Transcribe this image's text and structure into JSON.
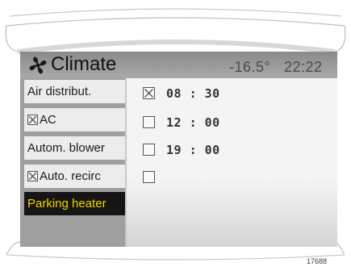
{
  "header": {
    "title": "Climate",
    "fan_icon": "fan-icon",
    "temperature": "-16.5°",
    "clock": "22:22"
  },
  "sidebar": {
    "items": [
      {
        "label": "Air distribut.",
        "checkbox": false,
        "checked": false,
        "selected": false
      },
      {
        "label": "AC",
        "checkbox": true,
        "checked": true,
        "selected": false
      },
      {
        "label": "Autom. blower",
        "checkbox": false,
        "checked": false,
        "selected": false
      },
      {
        "label": "Auto. recirc",
        "checkbox": true,
        "checked": true,
        "selected": false
      },
      {
        "label": "Parking heater",
        "checkbox": false,
        "checked": false,
        "selected": true
      }
    ]
  },
  "timers": [
    {
      "time": "08 : 30",
      "checked": true
    },
    {
      "time": "12 : 00",
      "checked": false
    },
    {
      "time": "19 : 00",
      "checked": false
    },
    {
      "time": "",
      "checked": false
    }
  ],
  "reference_number": "17688",
  "colors": {
    "selected_bg": "#151515",
    "selected_text": "#f5d400",
    "menu_bg": "#ececec",
    "frame": "#9b9b9b"
  }
}
